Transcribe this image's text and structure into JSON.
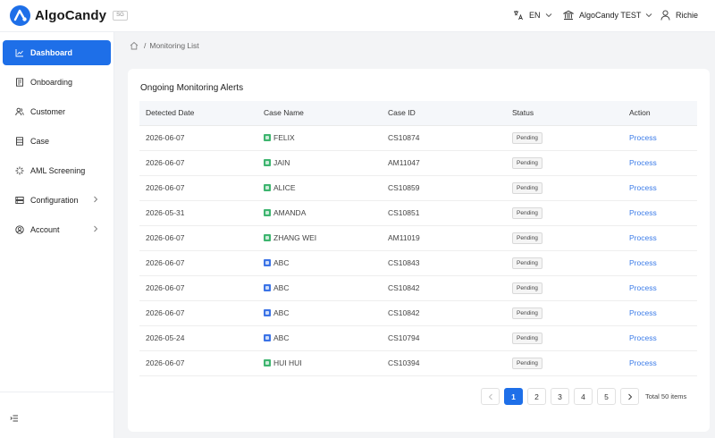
{
  "app": {
    "brand_name": "AlgoCandy",
    "region_badge": "SG",
    "brand_color": "#1e6fe8"
  },
  "header": {
    "language": "EN",
    "tenant": "AlgoCandy TEST",
    "user": "Richie"
  },
  "sidebar": {
    "items": [
      {
        "label": "Dashboard",
        "icon": "chart-line-icon",
        "active": true
      },
      {
        "label": "Onboarding",
        "icon": "document-icon"
      },
      {
        "label": "Customer",
        "icon": "users-icon"
      },
      {
        "label": "Case",
        "icon": "folder-icon"
      },
      {
        "label": "AML Screening",
        "icon": "scan-icon"
      },
      {
        "label": "Configuration",
        "icon": "config-icon",
        "has_submenu": true
      },
      {
        "label": "Account",
        "icon": "account-icon",
        "has_submenu": true
      }
    ],
    "collapse_icon": "menu-collapse-icon"
  },
  "breadcrumb": {
    "home_icon": "home-icon",
    "separator": "/",
    "current": "Monitoring List"
  },
  "card": {
    "title": "Ongoing Monitoring Alerts"
  },
  "table": {
    "columns": [
      "Detected Date",
      "Case Name",
      "Case ID",
      "Status",
      "Action"
    ],
    "rows": [
      {
        "date": "2026-06-07",
        "type": "person",
        "name": "FELIX",
        "case_id": "CS10874",
        "status": "Pending",
        "action": "Process"
      },
      {
        "date": "2026-06-07",
        "type": "person",
        "name": "JAIN",
        "case_id": "AM11047",
        "status": "Pending",
        "action": "Process"
      },
      {
        "date": "2026-06-07",
        "type": "person",
        "name": "ALICE",
        "case_id": "CS10859",
        "status": "Pending",
        "action": "Process"
      },
      {
        "date": "2026-05-31",
        "type": "person",
        "name": "AMANDA",
        "case_id": "CS10851",
        "status": "Pending",
        "action": "Process"
      },
      {
        "date": "2026-06-07",
        "type": "person",
        "name": "ZHANG WEI",
        "case_id": "AM11019",
        "status": "Pending",
        "action": "Process"
      },
      {
        "date": "2026-06-07",
        "type": "org",
        "name": "ABC",
        "case_id": "CS10843",
        "status": "Pending",
        "action": "Process"
      },
      {
        "date": "2026-06-07",
        "type": "org",
        "name": "ABC",
        "case_id": "CS10842",
        "status": "Pending",
        "action": "Process"
      },
      {
        "date": "2026-06-07",
        "type": "org",
        "name": "ABC",
        "case_id": "CS10842",
        "status": "Pending",
        "action": "Process"
      },
      {
        "date": "2026-05-24",
        "type": "org",
        "name": "ABC",
        "case_id": "CS10794",
        "status": "Pending",
        "action": "Process"
      },
      {
        "date": "2026-06-07",
        "type": "person",
        "name": "HUI HUI",
        "case_id": "CS10394",
        "status": "Pending",
        "action": "Process"
      }
    ]
  },
  "pagination": {
    "pages": [
      "1",
      "2",
      "3",
      "4",
      "5"
    ],
    "current_page": "1",
    "total_text": "Total 50 items"
  },
  "colors": {
    "accent": "#1e6fe8",
    "person_icon": "#3eb56f",
    "org_icon": "#3b73e6",
    "link": "#3b7be8"
  }
}
